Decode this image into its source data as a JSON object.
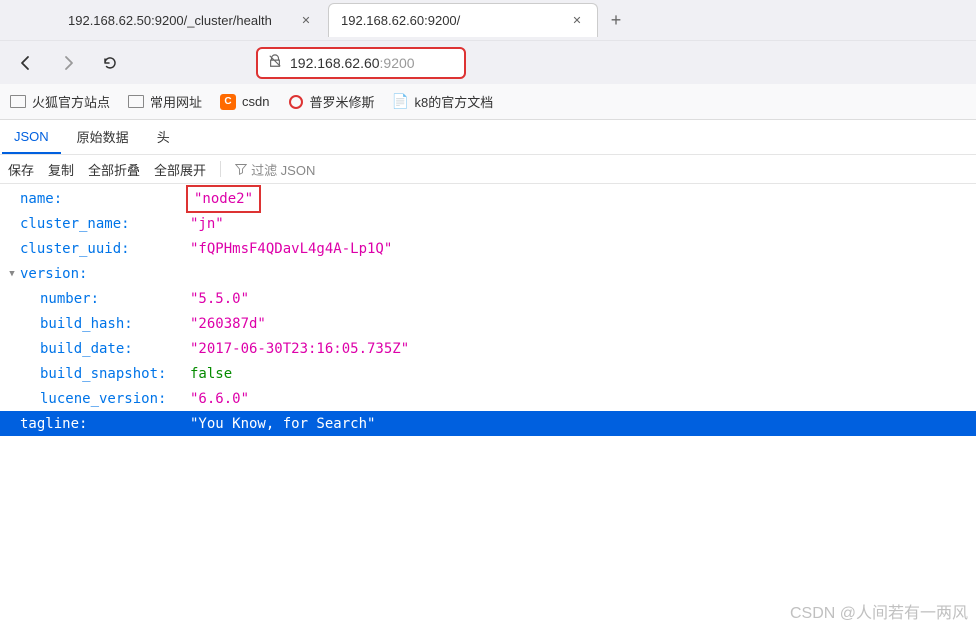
{
  "tabs": {
    "inactive": {
      "title": "192.168.62.50:9200/_cluster/health"
    },
    "active": {
      "title": "192.168.62.60:9200/"
    }
  },
  "urlbar": {
    "host": "192.168.62.60",
    "port": ":9200"
  },
  "bookmarks": {
    "b0": "火狐官方站点",
    "b1": "常用网址",
    "b2": "csdn",
    "b3": "普罗米修斯",
    "b4": "k8的官方文档"
  },
  "resp_tabs": {
    "json": "JSON",
    "raw": "原始数据",
    "headers": "头"
  },
  "toolbar": {
    "save": "保存",
    "copy": "复制",
    "collapse": "全部折叠",
    "expand": "全部展开",
    "filter": "过滤 JSON"
  },
  "json": {
    "name_key": "name:",
    "name_val": "\"node2\"",
    "cluster_name_key": "cluster_name:",
    "cluster_name_val": "\"jn\"",
    "cluster_uuid_key": "cluster_uuid:",
    "cluster_uuid_val": "\"fQPHmsF4QDavL4g4A-Lp1Q\"",
    "version_key": "version:",
    "number_key": "number:",
    "number_val": "\"5.5.0\"",
    "build_hash_key": "build_hash:",
    "build_hash_val": "\"260387d\"",
    "build_date_key": "build_date:",
    "build_date_val": "\"2017-06-30T23:16:05.735Z\"",
    "build_snapshot_key": "build_snapshot:",
    "build_snapshot_val": "false",
    "lucene_version_key": "lucene_version:",
    "lucene_version_val": "\"6.6.0\"",
    "tagline_key": "tagline:",
    "tagline_val": "\"You Know, for Search\""
  },
  "watermark": "CSDN @人间若有一两风"
}
